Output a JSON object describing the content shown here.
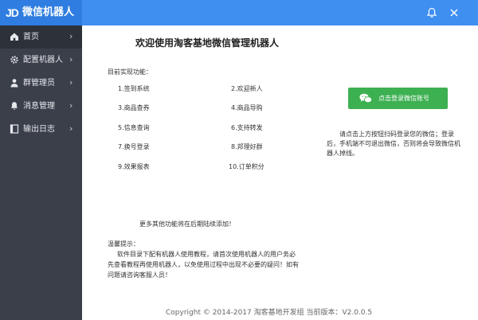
{
  "header": {
    "logo": "JD",
    "title": "微信机器人",
    "bell_icon": "bell-icon",
    "close_icon": "close-icon"
  },
  "sidebar": {
    "items": [
      {
        "label": "首页",
        "icon": "home-icon",
        "active": true
      },
      {
        "label": "配置机器人",
        "icon": "gear-icon",
        "active": false
      },
      {
        "label": "群管理员",
        "icon": "user-icon",
        "active": false
      },
      {
        "label": "消息管理",
        "icon": "bell-icon",
        "active": false
      },
      {
        "label": "输出日志",
        "icon": "log-icon",
        "active": false
      }
    ],
    "chevron": "›"
  },
  "main": {
    "title": "欢迎使用淘客基地微信管理机器人",
    "features_label": "目前实现功能：",
    "features": [
      "1.签到系统",
      "2.欢迎新人",
      "3.商品查券",
      "4.商品导购",
      "5.信息查询",
      "6.支持转发",
      "7.换号登录",
      "8.邦理好群",
      "9.效果报表",
      "10.订单积分"
    ],
    "more_text": "更多其他功能将在后期陆续添加！",
    "tips_title": "温馨提示：",
    "tips_body": "软件目录下配有机器人使用教程，请首次使用机器人的用户务必先查看教程再使用机器人，以免使用过程中出现不必要的疑问！如有问题请咨询客服人员！",
    "login_button": "点击登录微信账号",
    "login_tip": "请点击上方按钮扫码登录您的微信；登录后，手机端不可退出微信，否则将会导致微信机器人掉线。"
  },
  "footer": {
    "text": "Copyright © 2014-2017 淘客基地开发组   当前版本：V2.0.0.5"
  },
  "colors": {
    "header": "#3f8ff0",
    "sidebar": "#3a3f4a",
    "sidebar_active": "#2c313a",
    "login_button": "#3db052"
  }
}
